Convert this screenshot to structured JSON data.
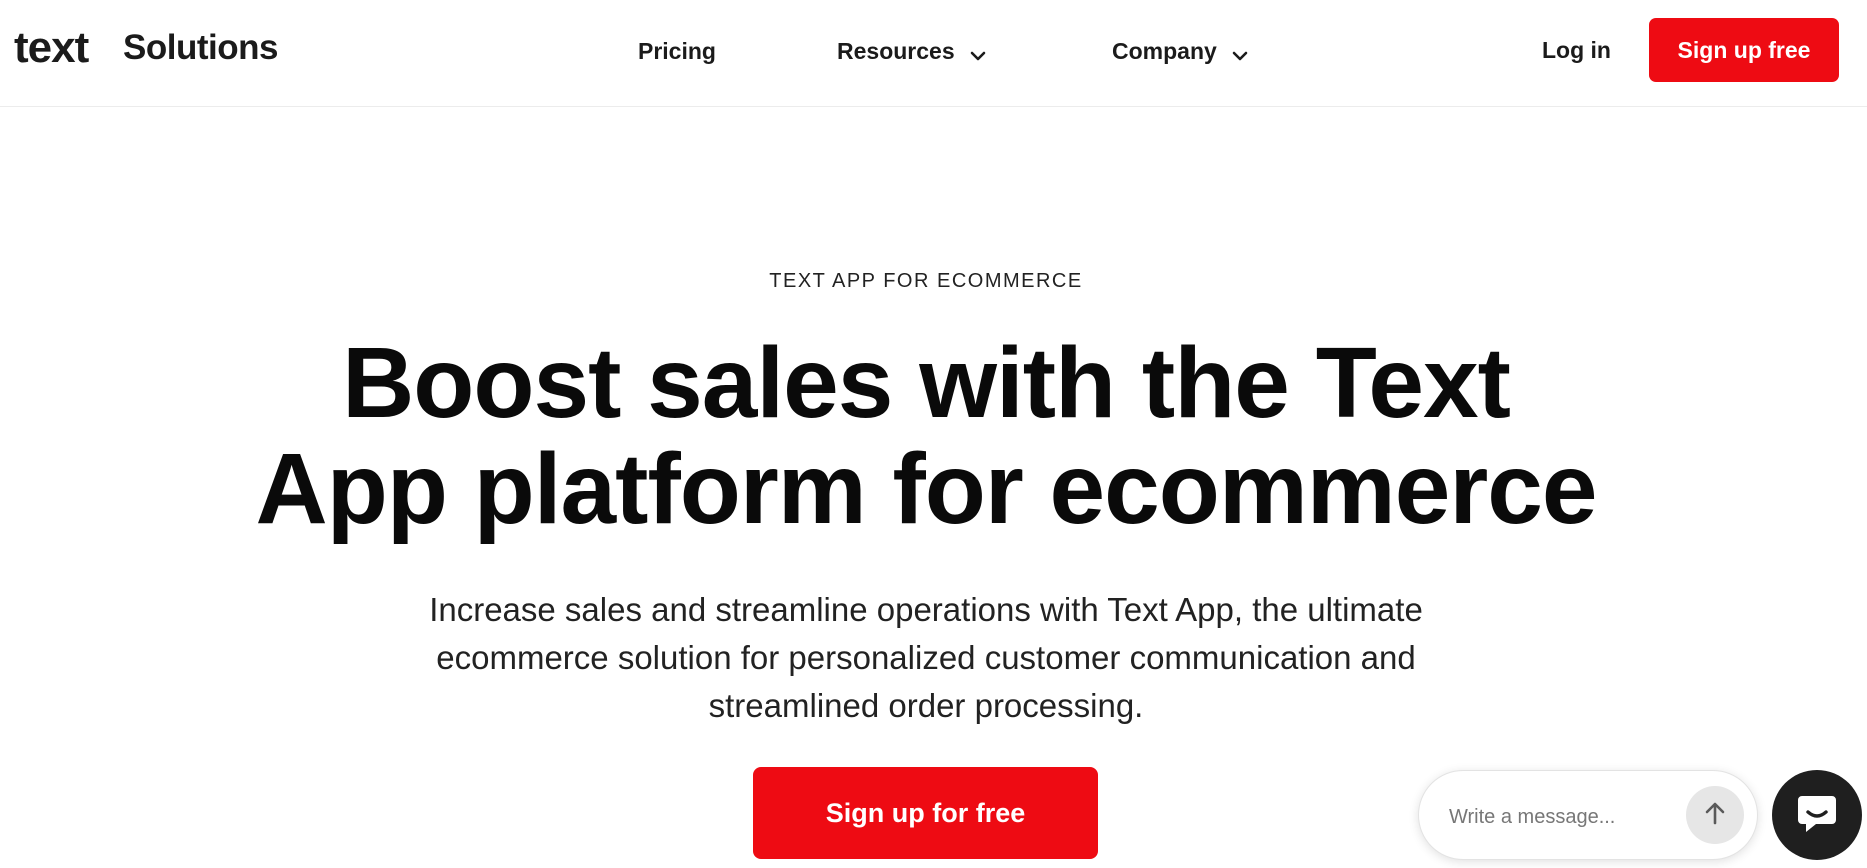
{
  "header": {
    "logo_text": "text",
    "logo_subtext": "Solutions",
    "nav": [
      {
        "label": "Pricing"
      },
      {
        "label": "Resources"
      },
      {
        "label": "Company"
      }
    ],
    "login_label": "Log in",
    "signup_label": "Sign up free"
  },
  "hero": {
    "eyebrow": "TEXT APP FOR ECOMMERCE",
    "headline_line1": "Boost sales with the Text",
    "headline_line2": "App platform for ecommerce",
    "subtext_line1": "Increase sales and streamline operations with Text App, the ultimate",
    "subtext_line2": "ecommerce solution for personalized customer communication and",
    "subtext_line3": "streamlined order processing.",
    "cta_label": "Sign up for free"
  },
  "chat": {
    "placeholder": "Write a message..."
  },
  "icons": {
    "chevron": "chevron-down-icon",
    "send": "arrow-up-icon",
    "chat": "chat-bubble-icon"
  },
  "colors": {
    "accent": "#ee0b13",
    "launcher": "#1f1f1f"
  }
}
